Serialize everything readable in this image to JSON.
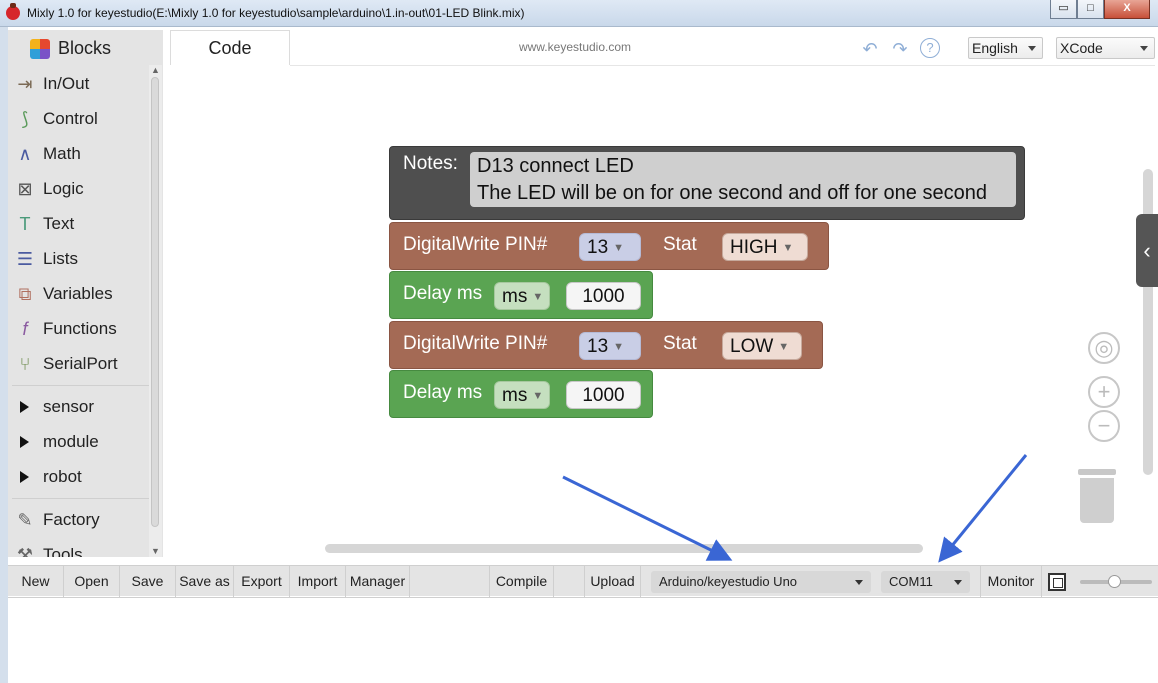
{
  "window": {
    "title": "Mixly 1.0 for keyestudio(E:\\Mixly 1.0 for keyestudio\\sample\\arduino\\1.in-out\\01-LED Blink.mix)",
    "minimize": "▭",
    "maximize": "□",
    "close": "X"
  },
  "sidebar": {
    "tab_label": "Blocks",
    "categories": [
      {
        "label": "In/Out",
        "icon": "in-out-icon"
      },
      {
        "label": "Control",
        "icon": "control-icon"
      },
      {
        "label": "Math",
        "icon": "math-icon"
      },
      {
        "label": "Logic",
        "icon": "logic-icon"
      },
      {
        "label": "Text",
        "icon": "text-icon"
      },
      {
        "label": "Lists",
        "icon": "lists-icon"
      },
      {
        "label": "Variables",
        "icon": "variables-icon"
      },
      {
        "label": "Functions",
        "icon": "functions-icon"
      },
      {
        "label": "SerialPort",
        "icon": "serialport-icon"
      }
    ],
    "groups": [
      "sensor",
      "module",
      "robot"
    ],
    "extra": [
      {
        "label": "Factory",
        "icon": "factory-icon"
      },
      {
        "label": "Tools",
        "icon": "tools-icon"
      }
    ]
  },
  "topbar": {
    "code_tab": "Code",
    "site": "www.keyestudio.com",
    "undo_icon": "↶",
    "redo_icon": "↷",
    "help_icon": "?",
    "language": "English",
    "theme": "XCode"
  },
  "blocks": {
    "notes_label": "Notes:",
    "notes_line1": "D13 connect LED",
    "notes_line2": "The LED will be on for one second and off for one second",
    "dw1": {
      "label": "DigitalWrite PIN#",
      "pin": "13",
      "stat_label": "Stat",
      "state": "HIGH"
    },
    "delay1": {
      "label": "Delay ms",
      "unit": "ms",
      "value": "1000"
    },
    "dw2": {
      "label": "DigitalWrite PIN#",
      "pin": "13",
      "stat_label": "Stat",
      "state": "LOW"
    },
    "delay2": {
      "label": "Delay ms",
      "unit": "ms",
      "value": "1000"
    },
    "dropdown_glyph": "▼"
  },
  "workspace_controls": {
    "flyout_glyph": "‹",
    "center_glyph": "◎",
    "zoom_in": "+",
    "zoom_out": "−"
  },
  "toolbar": {
    "new": "New",
    "open": "Open",
    "save": "Save",
    "save_as": "Save as",
    "export": "Export",
    "import": "Import",
    "manager": "Manager",
    "compile": "Compile",
    "upload": "Upload",
    "board": "Arduino/keyestudio Uno",
    "port": "COM11",
    "monitor": "Monitor"
  },
  "colors": {
    "digitalwrite_block": "#a46a55",
    "delay_block": "#5aa452",
    "notes_block": "#4f4f4f",
    "annotation_arrow": "#3a66d4"
  }
}
